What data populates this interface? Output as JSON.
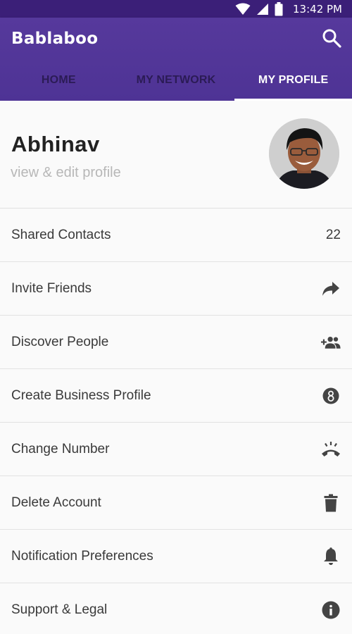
{
  "status_bar": {
    "time": "13:42 PM",
    "icons": [
      "wifi-icon",
      "signal-icon",
      "battery-icon"
    ]
  },
  "app_bar": {
    "title": "Bablaboo",
    "search_icon": "search-icon",
    "tabs": [
      {
        "label": "HOME",
        "active": false
      },
      {
        "label": "MY NETWORK",
        "active": false
      },
      {
        "label": "MY PROFILE",
        "active": true
      }
    ]
  },
  "profile": {
    "name": "Abhinav",
    "subtitle": "view & edit profile"
  },
  "menu": {
    "items": [
      {
        "label": "Shared Contacts",
        "value": "22"
      },
      {
        "label": "Invite Friends",
        "icon": "share-icon"
      },
      {
        "label": "Discover People",
        "icon": "add-people-icon"
      },
      {
        "label": "Create Business Profile",
        "icon": "business-icon"
      },
      {
        "label": "Change Number",
        "icon": "phone-ringing-icon"
      },
      {
        "label": "Delete Account",
        "icon": "trash-icon"
      },
      {
        "label": "Notification Preferences",
        "icon": "bell-icon"
      },
      {
        "label": "Support & Legal",
        "icon": "info-icon"
      }
    ]
  },
  "colors": {
    "status_bar": "#3b1f78",
    "app_bar": "#53379a",
    "tab_inactive": "#2b1b55",
    "accent": "#ffffff"
  }
}
